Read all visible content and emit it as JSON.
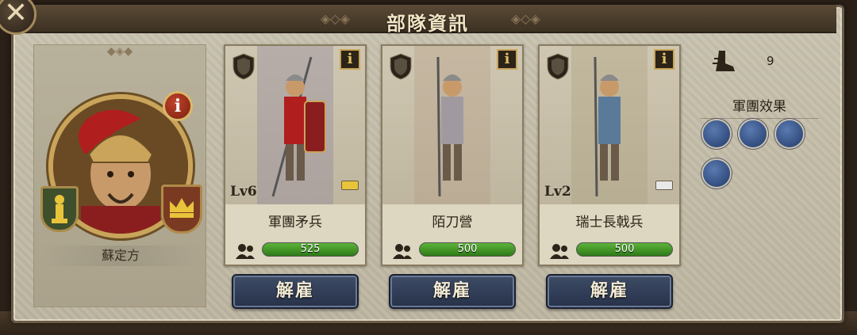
{
  "window": {
    "title": "部隊資訊"
  },
  "commander": {
    "name": "蘇定方",
    "info_label": "i"
  },
  "units": [
    {
      "name": "軍團矛兵",
      "level": "Lv6",
      "troops": "525",
      "troop_fraction": 1.0,
      "info_label": "i",
      "rank_color": "#e8c43a"
    },
    {
      "name": "陌刀營",
      "level": "",
      "troops": "500",
      "troop_fraction": 1.0,
      "info_label": "i",
      "rank_color": ""
    },
    {
      "name": "瑞士長戟兵",
      "level": "Lv2",
      "troops": "500",
      "troop_fraction": 1.0,
      "info_label": "i",
      "rank_color": "#e8e8e8"
    }
  ],
  "actions": {
    "dismiss_label": "解雇"
  },
  "stats": {
    "speed_value": "9"
  },
  "effects": {
    "title": "軍團效果",
    "icons": [
      "cavalry-charge-icon",
      "spear-stance-icon",
      "shield-wall-icon",
      "defense-boost-icon"
    ]
  },
  "colors": {
    "troop_bar": "#3a9a22",
    "dismiss_button": "#2f3b55",
    "title_bar": "#4a3c2c"
  }
}
